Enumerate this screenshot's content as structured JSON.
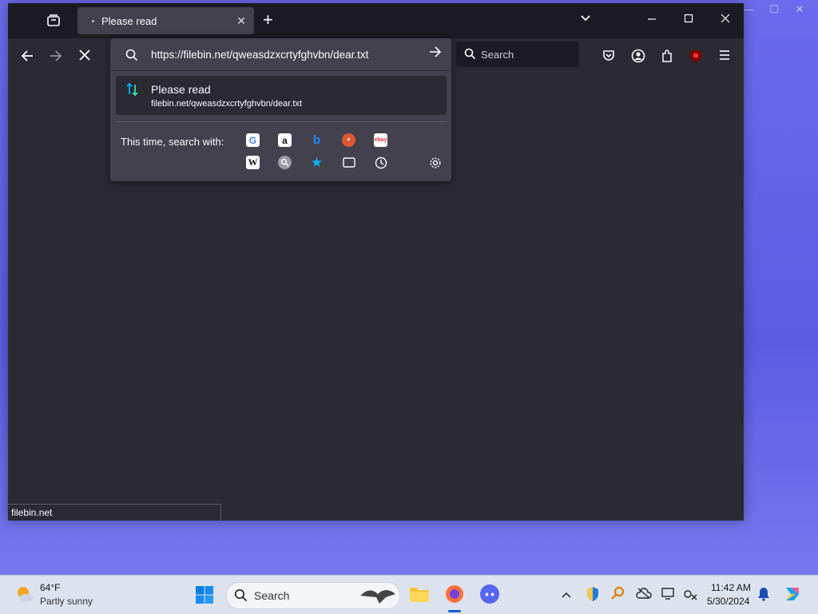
{
  "browser": {
    "tab": {
      "title": "Please read",
      "close_glyph": "✕"
    },
    "new_tab_glyph": "+",
    "search": {
      "placeholder": "Search"
    },
    "url_panel": {
      "url": "https://filebin.net/qweasdzxcrtyfghvbn/dear.txt",
      "suggestion": {
        "title": "Please read",
        "url": "filebin.net/qweasdzxcrtyfghvbn/dear.txt"
      },
      "search_with_label": "This time, search with:",
      "engines_row1": [
        "google-icon",
        "amazon-icon",
        "bing-icon",
        "duckduckgo-icon",
        "ebay-icon"
      ],
      "engines_row2": [
        "wikipedia-icon",
        "search-icon",
        "bookmarks-star-icon",
        "tabs-icon",
        "history-icon"
      ]
    },
    "status_text": "filebin.net"
  },
  "taskbar": {
    "weather": {
      "temp": "64°F",
      "desc": "Partly sunny"
    },
    "search_placeholder": "Search",
    "clock": {
      "time": "11:42 AM",
      "date": "5/30/2024"
    }
  },
  "colors": {
    "accent": "#00b3f4",
    "desktop": "#6262e6",
    "browser_bg": "#2b2a33",
    "panel": "#42414d"
  }
}
